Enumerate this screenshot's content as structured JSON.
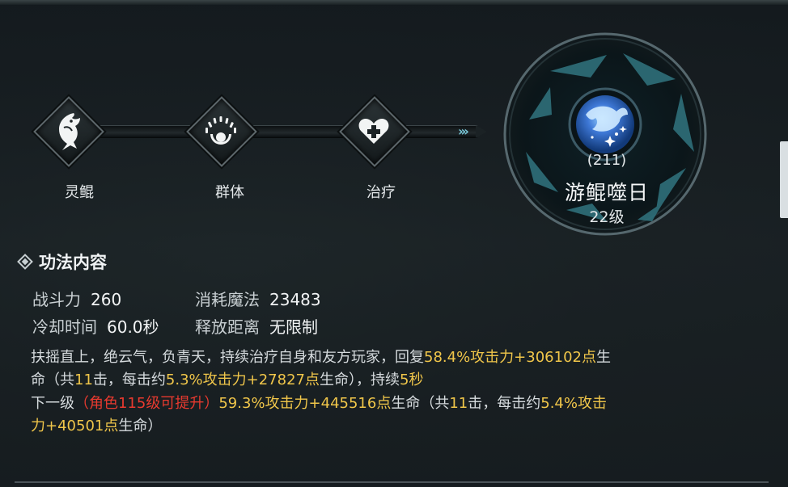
{
  "chain": {
    "nodes": [
      {
        "label": "灵鲲",
        "icon": "fish-icon"
      },
      {
        "label": "群体",
        "icon": "group-icon"
      },
      {
        "label": "治疗",
        "icon": "heal-heart-icon"
      }
    ],
    "arrow_icon": "triple-chevron-icon"
  },
  "skill": {
    "code": "(211)",
    "name": "游鲲噬日",
    "level": "22级",
    "emblem_icon": "whale-orb-icon"
  },
  "section": {
    "title": "功法内容",
    "bullet_icon": "diamond-bullet-icon"
  },
  "stats": {
    "power_label": "战斗力",
    "power_value": "260",
    "mana_label": "消耗魔法",
    "mana_value": "23483",
    "cooldown_label": "冷却时间",
    "cooldown_value": "60.0秒",
    "range_label": "释放距离",
    "range_value": "无限制"
  },
  "description": {
    "line1_a": "扶摇直上，绝云气，负青天，持续治疗自身和友方玩家，回复",
    "line1_b": "58.4%攻击力+306102点",
    "line1_c": "生",
    "line2_a": "命（共",
    "line2_b": "11",
    "line2_c": "击，每击约",
    "line2_d": "5.3%攻击力+27827点",
    "line2_e": "生命），持续",
    "line2_f": "5秒",
    "line3_a": "下一级",
    "line3_b": "（角色115级可提升）",
    "line3_c": "59.3%攻击力+445516点",
    "line3_d": "生命（共",
    "line3_e": "11",
    "line3_f": "击，每击约",
    "line3_g": "5.4%攻击",
    "line4_a": "力+40501点",
    "line4_b": "生命）"
  },
  "colors": {
    "highlight": "#f0c64a",
    "warning": "#e83a2f",
    "accent": "#78c7d8"
  }
}
